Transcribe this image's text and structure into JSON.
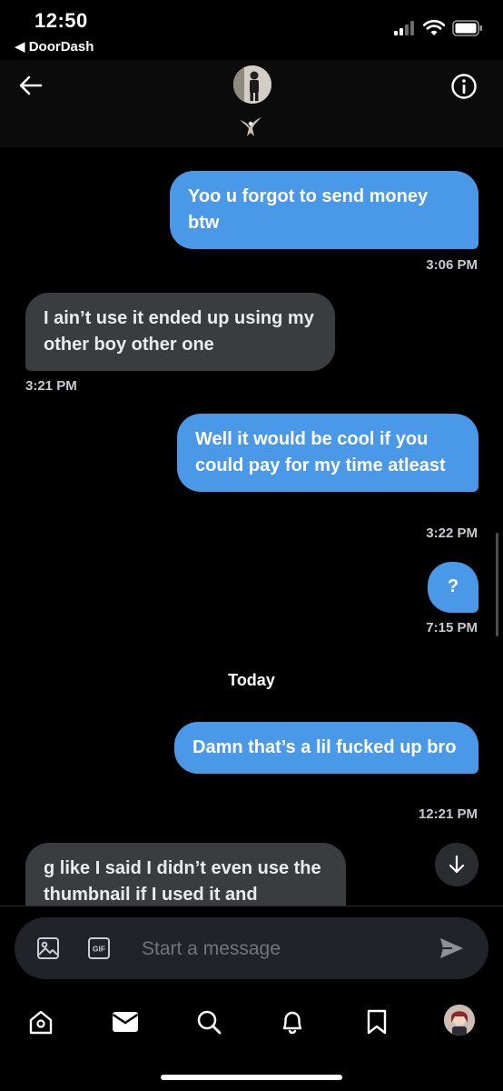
{
  "status_bar": {
    "time": "12:50",
    "back_app": "◀ DoorDash",
    "icons": [
      "signal-icon",
      "wifi-icon",
      "battery-icon"
    ]
  },
  "header": {
    "icons": [
      "back-arrow-icon",
      "eagle-icon",
      "info-icon"
    ]
  },
  "messages": [
    {
      "direction": "outgoing",
      "text": "Yoo u forgot to send money btw",
      "time": "3:06 PM"
    },
    {
      "direction": "incoming",
      "text": "I ain’t use it ended up using my other boy other one",
      "time": "3:21 PM"
    },
    {
      "direction": "outgoing",
      "text": "Well it would be cool if you could pay for my time atleast",
      "time": "3:22 PM"
    },
    {
      "direction": "outgoing",
      "text": "?",
      "time": "7:15 PM"
    },
    {
      "direction": "outgoing",
      "text": "Damn that’s a lil fucked up bro",
      "time": "12:21 PM"
    },
    {
      "direction": "incoming",
      "text": "g like I said I didn’t even use the thumbnail if I used it and",
      "time": ""
    }
  ],
  "date_separator": "Today",
  "composer": {
    "placeholder": "Start a message",
    "gif_label": "GIF",
    "icons": [
      "image-icon",
      "gif-icon",
      "send-icon"
    ]
  },
  "tabs": [
    "home-icon",
    "messages-icon",
    "search-icon",
    "notifications-icon",
    "bookmarks-icon",
    "profile-avatar"
  ],
  "colors": {
    "background": "#000000",
    "outgoing_bubble": "#4a99e9",
    "incoming_bubble": "#3a3d40",
    "timestamp": "#c8ccd0",
    "composer_bg": "#202327"
  }
}
